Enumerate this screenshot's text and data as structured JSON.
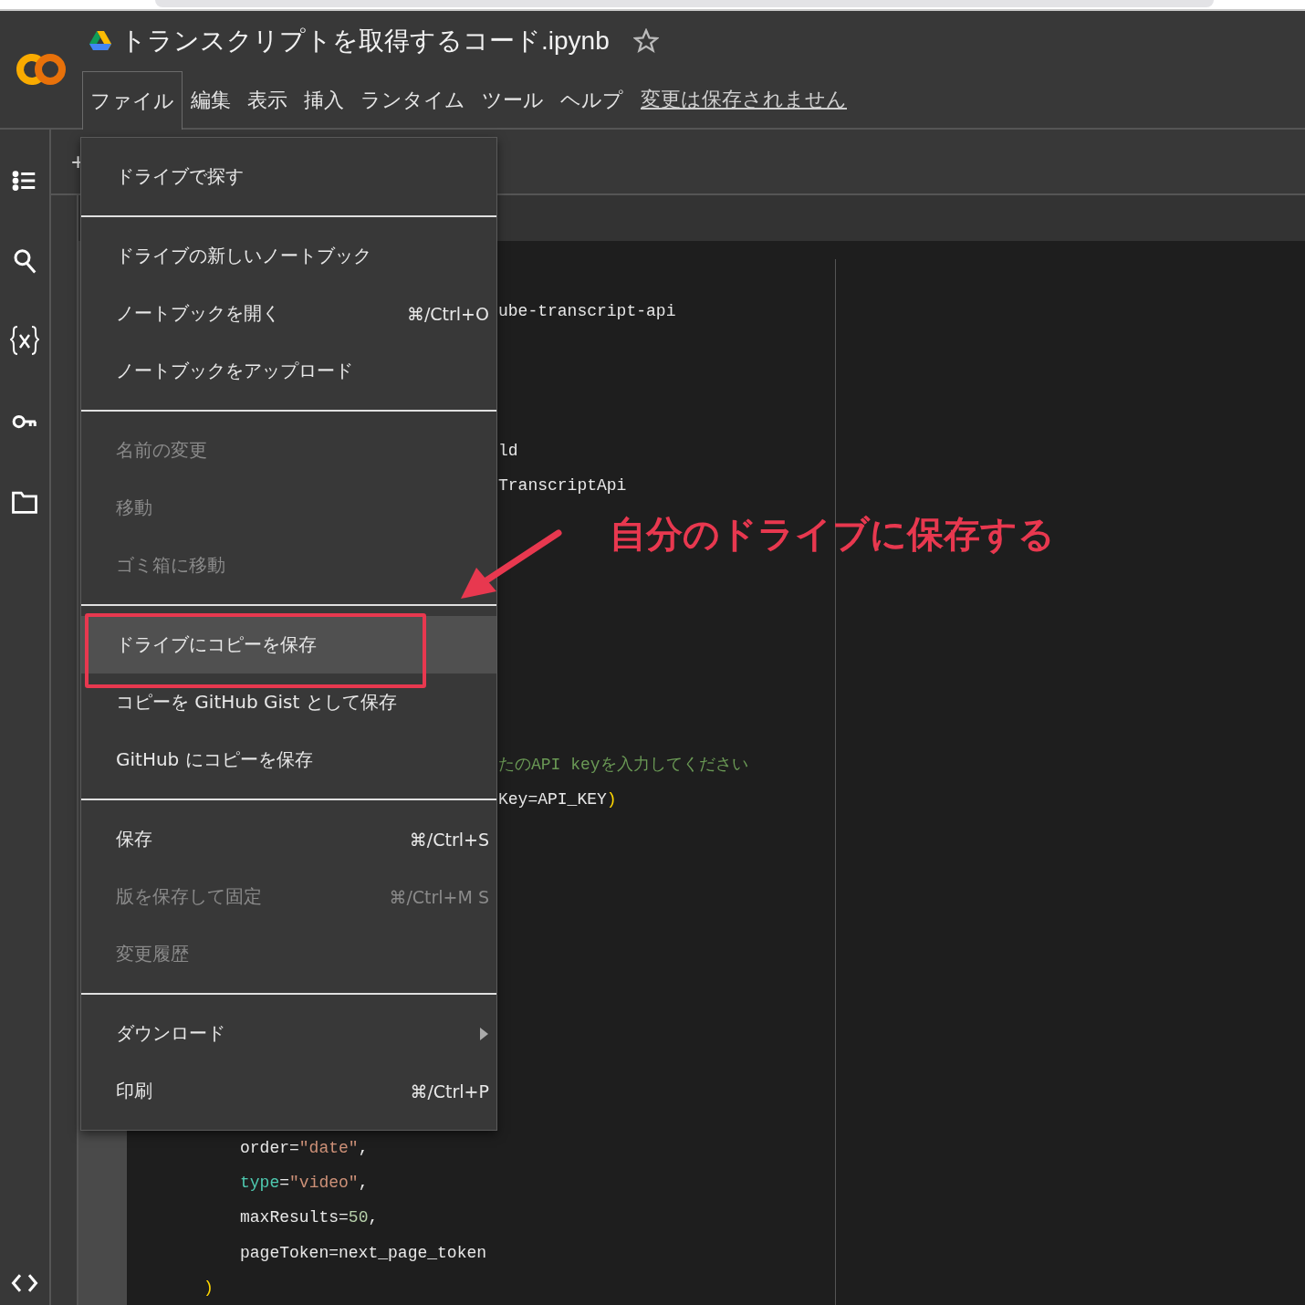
{
  "notebook": {
    "title": "トランスクリプトを取得するコード.ipynb",
    "starred": false
  },
  "menubar": [
    {
      "label": "ファイル",
      "selected": true
    },
    {
      "label": "編集",
      "selected": false
    },
    {
      "label": "表示",
      "selected": false
    },
    {
      "label": "挿入",
      "selected": false
    },
    {
      "label": "ランタイム",
      "selected": false
    },
    {
      "label": "ツール",
      "selected": false
    },
    {
      "label": "ヘルプ",
      "selected": false
    }
  ],
  "save_status": "変更は保存されません",
  "toolbar": {
    "add_label": "+"
  },
  "file_menu": {
    "sections": [
      [
        {
          "label": "ドライブで探す",
          "disabled": false,
          "selected": false
        }
      ],
      [
        {
          "label": "ドライブの新しいノートブック",
          "disabled": false,
          "selected": false
        },
        {
          "label": "ノートブックを開く",
          "shortcut": "⌘/Ctrl+O",
          "disabled": false,
          "selected": false
        },
        {
          "label": "ノートブックをアップロード",
          "disabled": false,
          "selected": false
        }
      ],
      [
        {
          "label": "名前の変更",
          "disabled": true,
          "selected": false
        },
        {
          "label": "移動",
          "disabled": true,
          "selected": false
        },
        {
          "label": "ゴミ箱に移動",
          "disabled": true,
          "selected": false
        }
      ],
      [
        {
          "label": "ドライブにコピーを保存",
          "disabled": false,
          "selected": true
        },
        {
          "label": "コピーを GitHub Gist として保存",
          "disabled": false,
          "selected": false
        },
        {
          "label": "GitHub にコピーを保存",
          "disabled": false,
          "selected": false
        }
      ],
      [
        {
          "label": "保存",
          "shortcut": "⌘/Ctrl+S",
          "disabled": false,
          "selected": false
        },
        {
          "label": "版を保存して固定",
          "shortcut": "⌘/Ctrl+M S",
          "disabled": true,
          "selected": false
        },
        {
          "label": "変更履歴",
          "disabled": true,
          "selected": false
        }
      ],
      [
        {
          "label": "ダウンロード",
          "submenu": true,
          "disabled": false,
          "selected": false
        },
        {
          "label": "印刷",
          "shortcut": "⌘/Ctrl+P",
          "disabled": false,
          "selected": false
        }
      ]
    ]
  },
  "code_lines": [
    {
      "kind": "clipped",
      "segments": [
        {
          "kind": "plain",
          "text": "ube-transcript-api"
        }
      ]
    },
    {
      "kind": "clipped",
      "segments": [
        {
          "kind": "plain",
          "text": "ld"
        }
      ]
    },
    {
      "kind": "clipped",
      "segments": [
        {
          "kind": "plain",
          "text": "TranscriptApi"
        }
      ]
    },
    {
      "kind": "clipped",
      "segments": [
        {
          "kind": "comment",
          "text": "たのAPI keyを入力してください"
        }
      ]
    },
    {
      "kind": "clipped",
      "segments": [
        {
          "kind": "plain",
          "text": "Key=API_KEY"
        },
        {
          "kind": "paren",
          "text": ")"
        }
      ]
    },
    {
      "kind": "arg",
      "segments": [
        {
          "kind": "plain",
          "text": "order="
        },
        {
          "kind": "string",
          "text": "\"date\""
        },
        {
          "kind": "plain",
          "text": ","
        }
      ]
    },
    {
      "kind": "arg",
      "segments": [
        {
          "kind": "keyword",
          "text": "type"
        },
        {
          "kind": "plain",
          "text": "="
        },
        {
          "kind": "string",
          "text": "\"video\""
        },
        {
          "kind": "plain",
          "text": ","
        }
      ]
    },
    {
      "kind": "arg",
      "segments": [
        {
          "kind": "plain",
          "text": "maxResults="
        },
        {
          "kind": "number",
          "text": "50"
        },
        {
          "kind": "plain",
          "text": ","
        }
      ]
    },
    {
      "kind": "arg",
      "segments": [
        {
          "kind": "plain",
          "text": "pageToken=next_page_token"
        }
      ]
    },
    {
      "kind": "close",
      "segments": [
        {
          "kind": "paren",
          "text": ")"
        }
      ]
    }
  ],
  "annotation": {
    "text": "自分のドライブに保存する"
  }
}
